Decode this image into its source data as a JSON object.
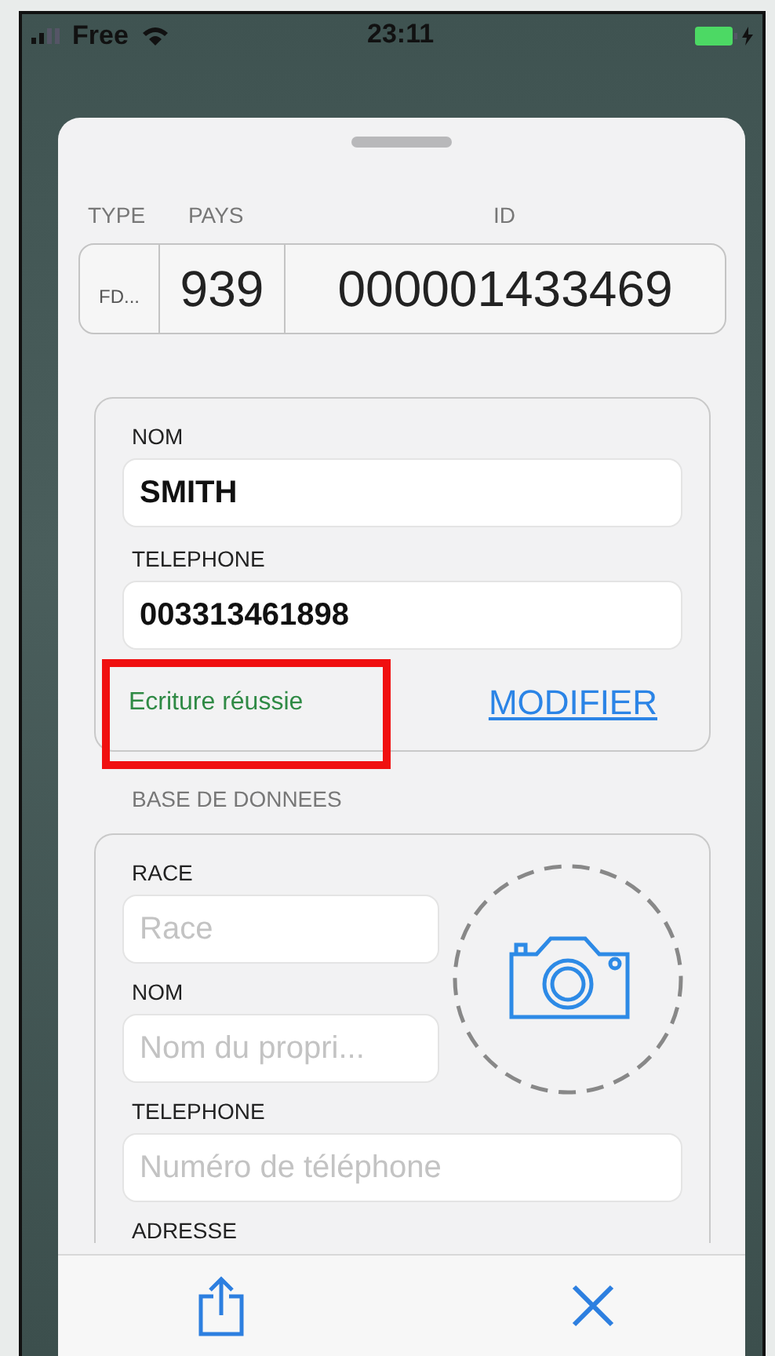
{
  "status_bar": {
    "carrier": "Free",
    "time": "23:11"
  },
  "identifier": {
    "headers": [
      "TYPE",
      "PAYS",
      "ID"
    ],
    "values": [
      "FD...",
      "939",
      "000001433469"
    ]
  },
  "owner_card": {
    "fields": [
      {
        "label": "NOM",
        "value": "SMITH"
      },
      {
        "label": "TELEPHONE",
        "value": "003313461898"
      }
    ],
    "status": "Ecriture réussie",
    "action": "MODIFIER"
  },
  "database": {
    "title": "BASE DE DONNEES",
    "fields": [
      {
        "label": "RACE",
        "placeholder": "Race"
      },
      {
        "label": "NOM",
        "placeholder": "Nom du propri..."
      },
      {
        "label": "TELEPHONE",
        "placeholder": "Numéro de téléphone"
      }
    ],
    "cut_label": "ADRESSE"
  }
}
